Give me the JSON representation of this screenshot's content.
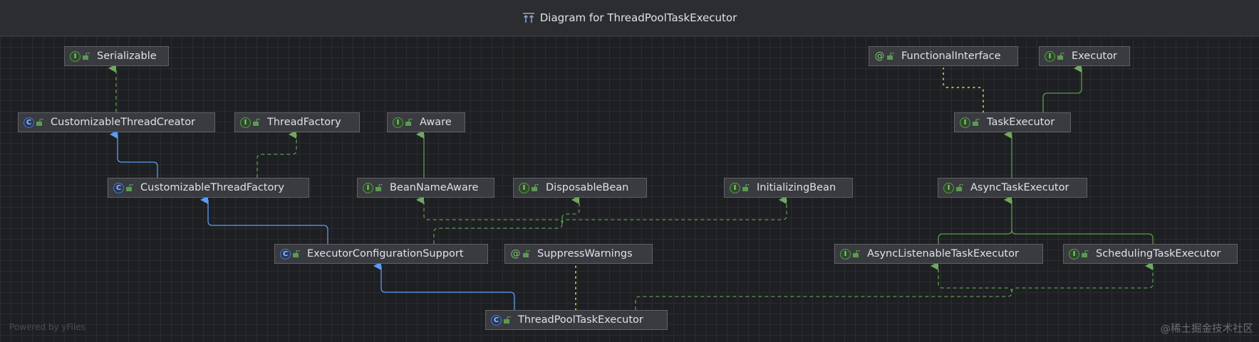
{
  "window": {
    "title": "Diagram for ThreadPoolTaskExecutor"
  },
  "legend_colors": {
    "extends": "#589df6",
    "implements": "#5b9b4f",
    "annotation": "#b4b43a"
  },
  "nodes": {
    "serializable": {
      "label": "Serializable",
      "kind": "interface"
    },
    "customizable_thread_creator": {
      "label": "CustomizableThreadCreator",
      "kind": "class"
    },
    "thread_factory": {
      "label": "ThreadFactory",
      "kind": "interface"
    },
    "aware": {
      "label": "Aware",
      "kind": "interface"
    },
    "customizable_thread_factory": {
      "label": "CustomizableThreadFactory",
      "kind": "class"
    },
    "bean_name_aware": {
      "label": "BeanNameAware",
      "kind": "interface"
    },
    "disposable_bean": {
      "label": "DisposableBean",
      "kind": "interface"
    },
    "initializing_bean": {
      "label": "InitializingBean",
      "kind": "interface"
    },
    "executor_configuration_support": {
      "label": "ExecutorConfigurationSupport",
      "kind": "class"
    },
    "suppress_warnings": {
      "label": "SuppressWarnings",
      "kind": "annotation"
    },
    "thread_pool_task_executor": {
      "label": "ThreadPoolTaskExecutor",
      "kind": "class"
    },
    "functional_interface": {
      "label": "FunctionalInterface",
      "kind": "annotation"
    },
    "executor": {
      "label": "Executor",
      "kind": "interface"
    },
    "task_executor": {
      "label": "TaskExecutor",
      "kind": "interface"
    },
    "async_task_executor": {
      "label": "AsyncTaskExecutor",
      "kind": "interface"
    },
    "async_listenable_task_executor": {
      "label": "AsyncListenableTaskExecutor",
      "kind": "interface"
    },
    "scheduling_task_executor": {
      "label": "SchedulingTaskExecutor",
      "kind": "interface"
    }
  },
  "footer": {
    "powered_by": "Powered by yFiles",
    "site_watermark": "@稀土掘金技术社区"
  }
}
